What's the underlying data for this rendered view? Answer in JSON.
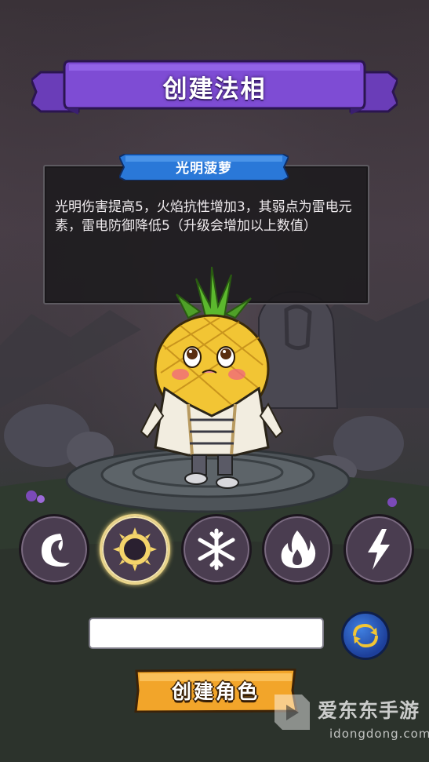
{
  "header": {
    "title": "创建法相"
  },
  "info": {
    "name": "光明菠萝",
    "description": "光明伤害提高5，火焰抗性增加3，其弱点为雷电元素，雷电防御降低5（升级会增加以上数值）"
  },
  "elements": [
    {
      "name": "dark",
      "icon": "crescent-moon-icon",
      "selected": false
    },
    {
      "name": "light",
      "icon": "sun-ring-icon",
      "selected": true
    },
    {
      "name": "ice",
      "icon": "snowflake-icon",
      "selected": false
    },
    {
      "name": "fire",
      "icon": "flame-icon",
      "selected": false
    },
    {
      "name": "thunder",
      "icon": "lightning-icon",
      "selected": false
    }
  ],
  "name_input": {
    "value": "",
    "placeholder": ""
  },
  "create_button": {
    "label": "创建角色"
  },
  "watermark": {
    "brand": "爱东东手游",
    "url": "idongdong.com"
  },
  "colors": {
    "banner_purple": "#7b4ad0",
    "tab_blue": "#2a78d8",
    "create_orange": "#f2a52a",
    "refresh_blue": "#2e63c8"
  }
}
